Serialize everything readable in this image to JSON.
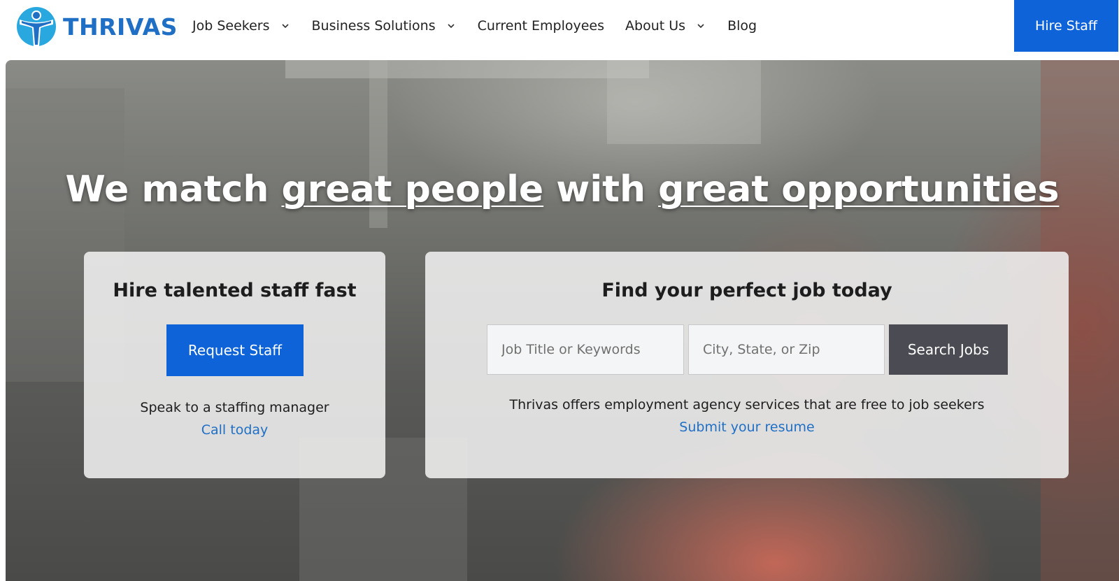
{
  "brand": {
    "name": "THRIVAS",
    "logo_icon": "person-logo-icon",
    "color": "#1f6fc5"
  },
  "nav": {
    "items": [
      {
        "label": "Job Seekers",
        "has_dropdown": true
      },
      {
        "label": "Business Solutions",
        "has_dropdown": true
      },
      {
        "label": "Current Employees",
        "has_dropdown": false
      },
      {
        "label": "About Us",
        "has_dropdown": true
      },
      {
        "label": "Blog",
        "has_dropdown": false
      }
    ],
    "cta_label": "Hire Staff",
    "cta_color": "#0e63d8"
  },
  "hero": {
    "headline": {
      "part1": "We match ",
      "part2": "great people",
      "part3": " with ",
      "part4": "great opportunities"
    }
  },
  "employer_card": {
    "title": "Hire talented staff fast",
    "button_label": "Request Staff",
    "text": "Speak to a staffing manager",
    "link_label": "Call today"
  },
  "job_card": {
    "title": "Find your perfect job today",
    "keywords_placeholder": "Job Title or Keywords",
    "location_placeholder": "City, State, or Zip",
    "search_label": "Search Jobs",
    "text": "Thrivas offers employment agency services that are free to job seekers",
    "link_label": "Submit your resume"
  }
}
